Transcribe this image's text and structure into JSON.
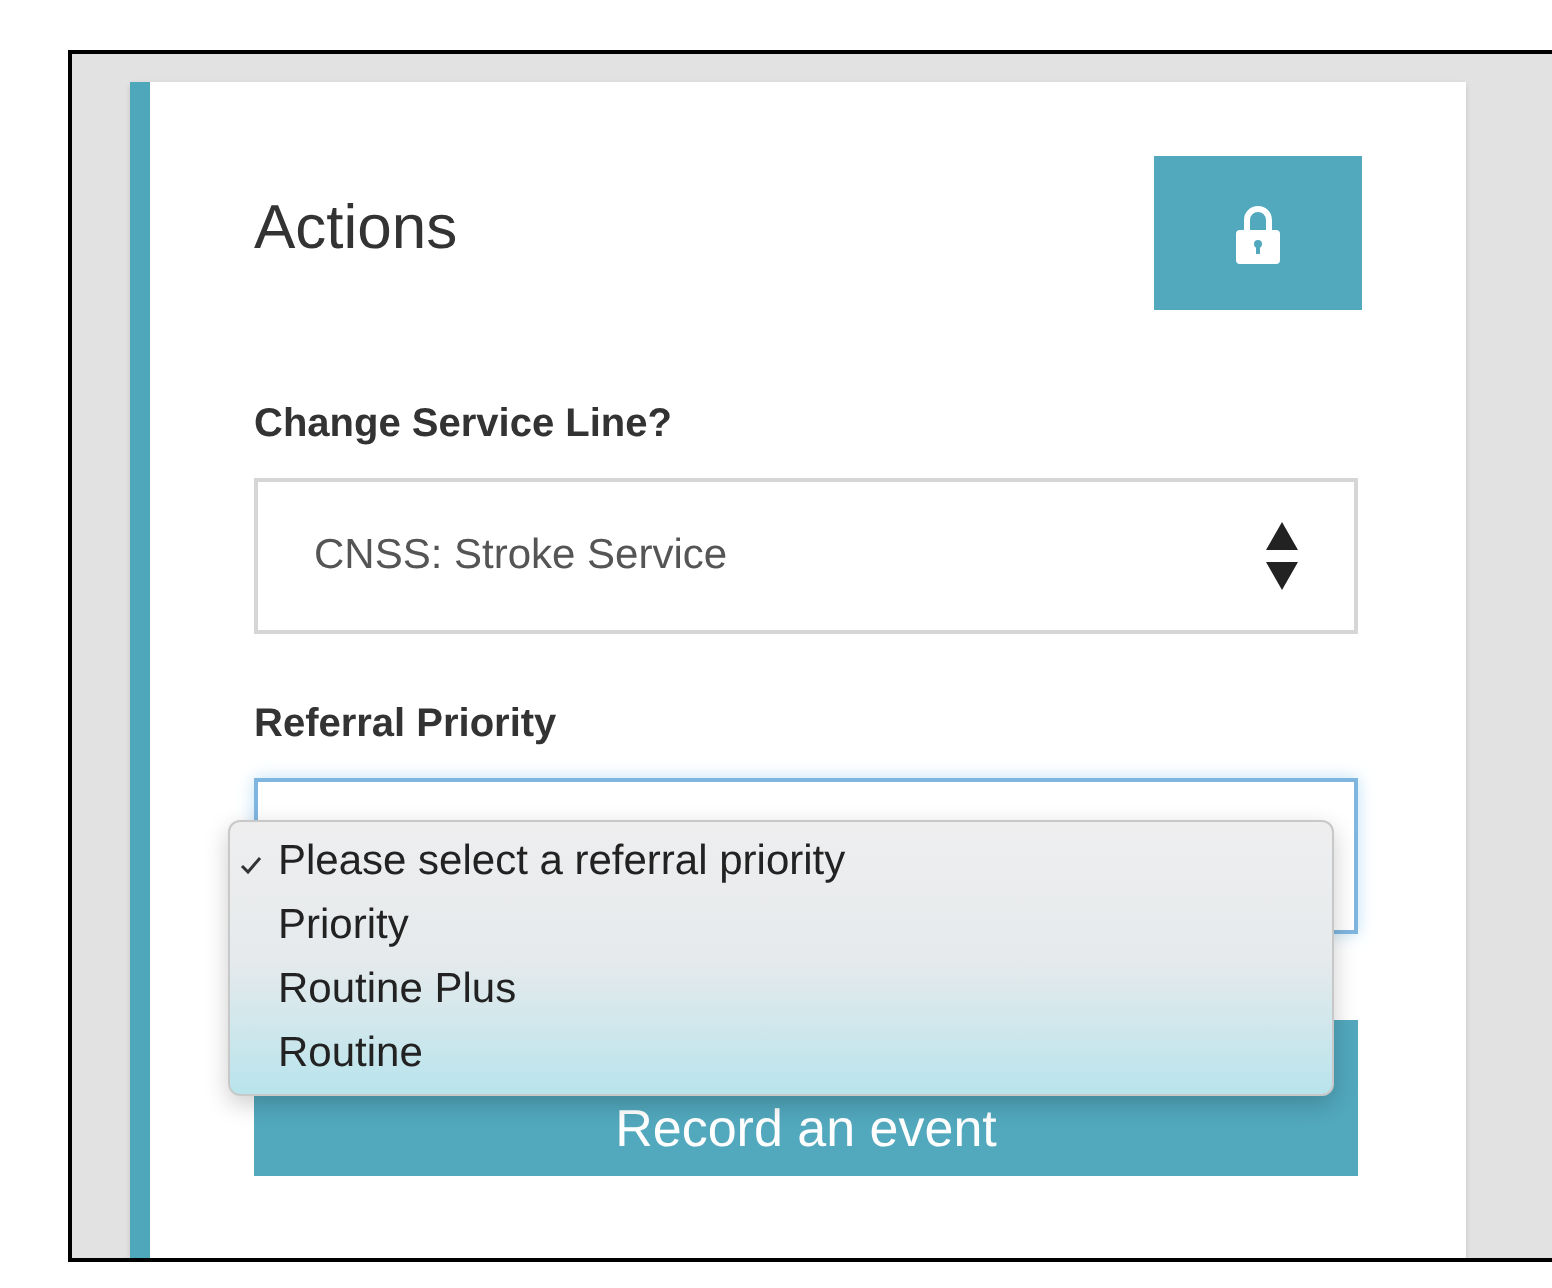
{
  "panel": {
    "title": "Actions"
  },
  "fields": [
    {
      "label": "Change Service Line?",
      "value": "CNSS: Stroke Service",
      "focused": false
    },
    {
      "label": "Referral Priority",
      "focused": true,
      "options": [
        {
          "label": "Please select a referral priority",
          "selected": true
        },
        {
          "label": "Priority",
          "selected": false
        },
        {
          "label": "Routine Plus",
          "selected": false
        },
        {
          "label": "Routine",
          "selected": false
        }
      ]
    }
  ],
  "primary_button": "Record an event"
}
